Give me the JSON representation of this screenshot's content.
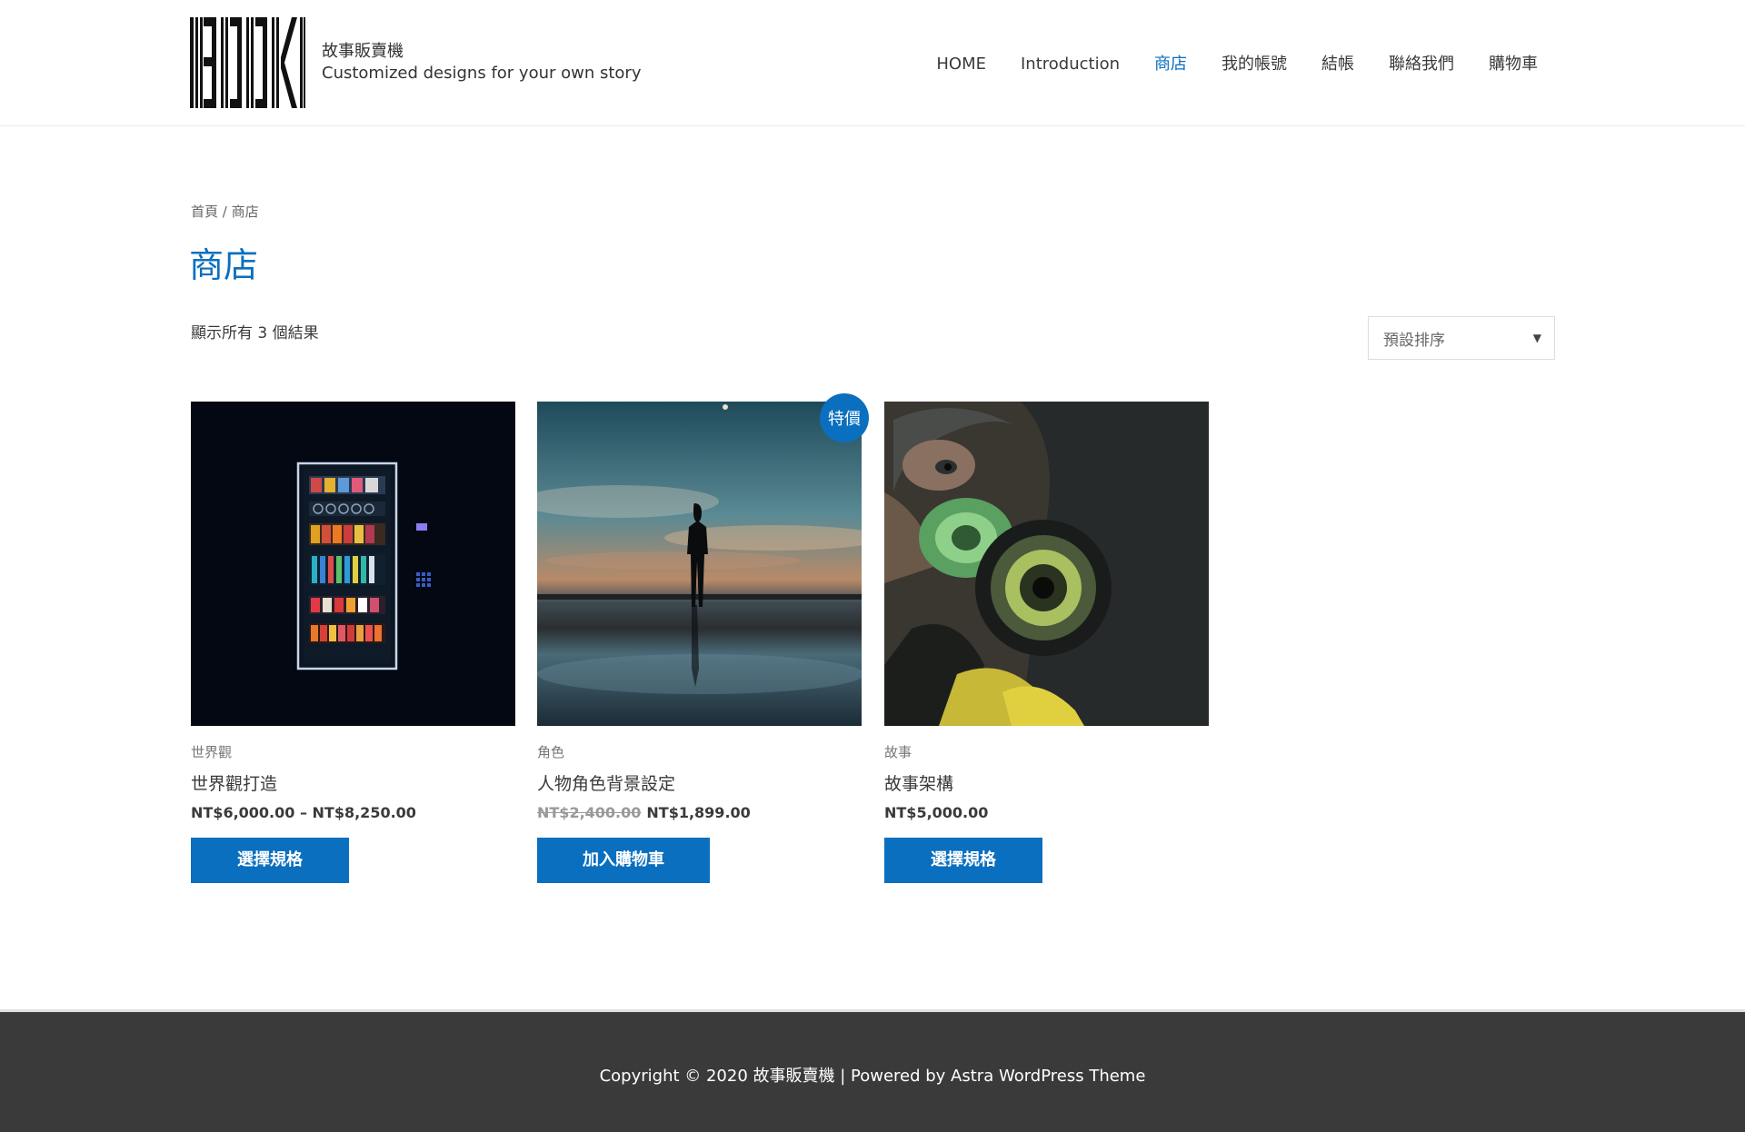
{
  "header": {
    "site_title": "故事販賣機",
    "tagline": "Customized designs for your own story",
    "nav": [
      {
        "label": "HOME",
        "active": false
      },
      {
        "label": "Introduction",
        "active": false
      },
      {
        "label": "商店",
        "active": true
      },
      {
        "label": "我的帳號",
        "active": false
      },
      {
        "label": "結帳",
        "active": false
      },
      {
        "label": "聯絡我們",
        "active": false
      },
      {
        "label": "購物車",
        "active": false
      }
    ]
  },
  "breadcrumb": {
    "home": "首頁",
    "separator": " / ",
    "current": "商店"
  },
  "page_title": "商店",
  "result_count": "顯示所有 3 個結果",
  "orderby": {
    "selected": "預設排序"
  },
  "products": [
    {
      "category": "世界觀",
      "name": "世界觀打造",
      "price": "NT$6,000.00 – NT$8,250.00",
      "button": "選擇規格"
    },
    {
      "category": "角色",
      "name": "人物角色背景設定",
      "regular_price": "NT$2,400.00",
      "sale_price": "NT$1,899.00",
      "badge": "特價",
      "button": "加入購物車"
    },
    {
      "category": "故事",
      "name": "故事架構",
      "price": "NT$5,000.00",
      "button": "選擇規格"
    }
  ],
  "footer": {
    "copyright": "Copyright © 2020 故事販賣機 | Powered by Astra WordPress Theme"
  },
  "colors": {
    "accent": "#0a6fbf",
    "footer_bg": "#3a3a3a"
  }
}
